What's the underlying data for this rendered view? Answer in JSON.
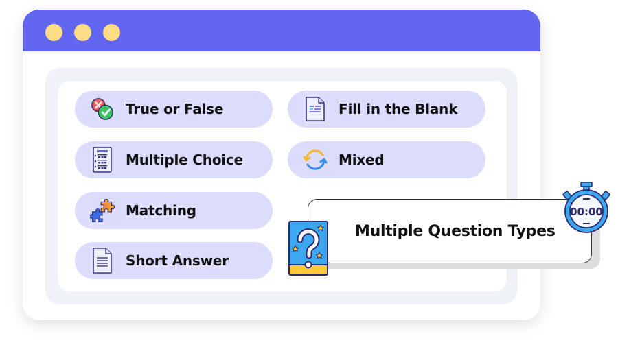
{
  "window": {
    "controls": [
      "dot",
      "dot",
      "dot"
    ],
    "accent_color": "#6366f0",
    "dot_color": "#ffdd86"
  },
  "question_types": [
    {
      "label": "True or False",
      "icon": "true-false-icon"
    },
    {
      "label": "Fill in the Blank",
      "icon": "fill-blank-document-icon"
    },
    {
      "label": "Multiple Choice",
      "icon": "multiple-choice-list-icon"
    },
    {
      "label": "Mixed",
      "icon": "refresh-cycle-icon"
    },
    {
      "label": "Matching",
      "icon": "puzzle-pieces-icon"
    },
    {
      "label": "Short Answer",
      "icon": "document-lines-icon"
    }
  ],
  "callout": {
    "title": "Multiple Question Types",
    "left_icon": "question-card-icon",
    "right_icon": "stopwatch-icon",
    "timer_text": "00:00"
  }
}
